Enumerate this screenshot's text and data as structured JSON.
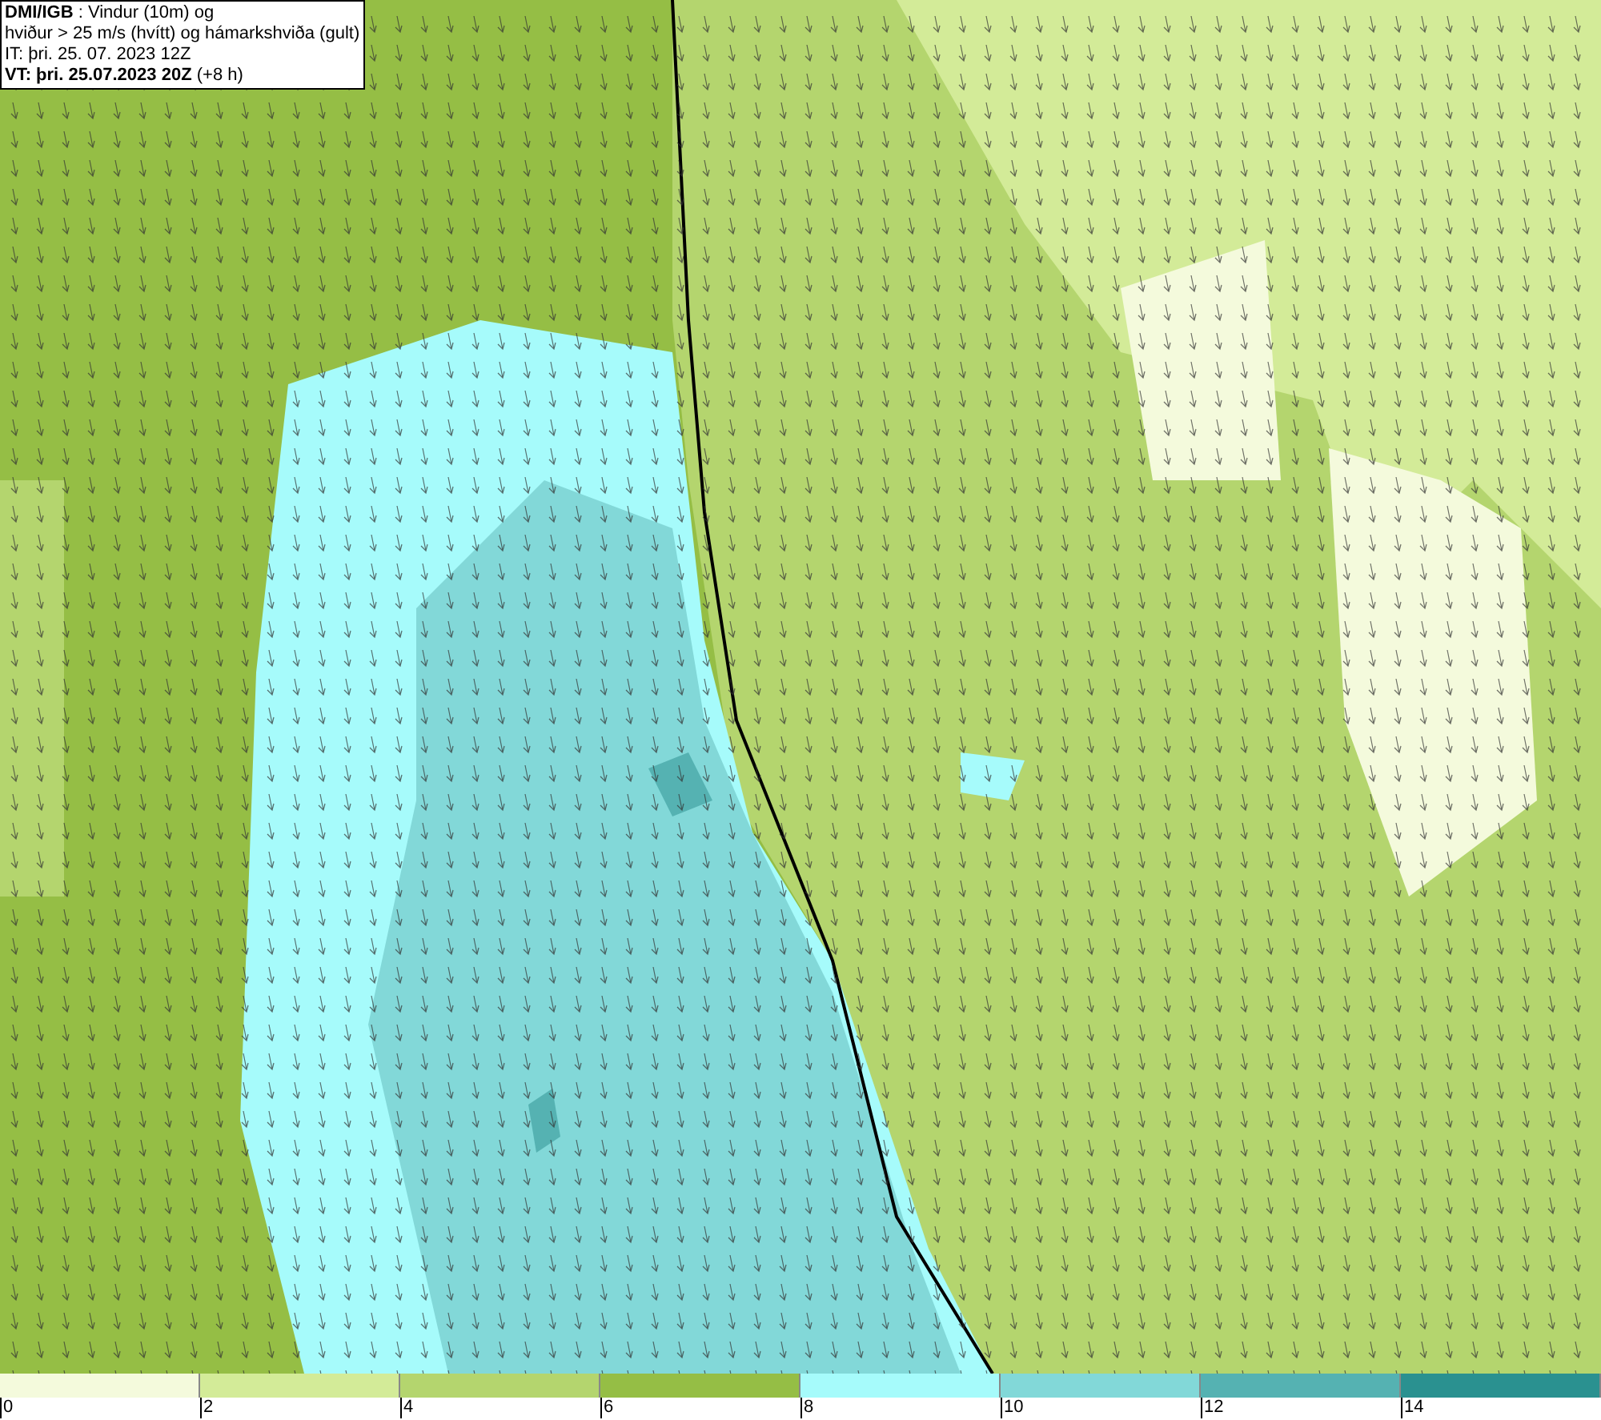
{
  "title_box": {
    "lines": [
      "**DMI/IGB** : Vindur (10m) og",
      "hviður > 25 m/s (hvítt) og hámarkshviða (gult)",
      "IT: þri. 25. 07. 2023 12Z",
      "**VT: þri. 25.07.2023 20Z** (+8 h)"
    ]
  },
  "legend": {
    "bins": [
      {
        "color": "#f4fadc"
      },
      {
        "color": "#d3eb98"
      },
      {
        "color": "#b4d56e"
      },
      {
        "color": "#95be45"
      },
      {
        "color": "#a6fbfb"
      },
      {
        "color": "#82d8d8"
      },
      {
        "color": "#55b2b2"
      },
      {
        "color": "#2a9190"
      }
    ],
    "ticks": [
      "0",
      "2",
      "4",
      "6",
      "8",
      "10",
      "12",
      "14"
    ]
  }
}
